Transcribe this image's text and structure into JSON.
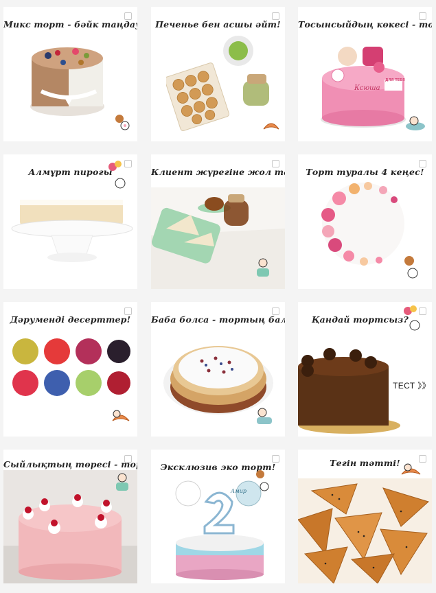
{
  "posts": [
    {
      "caption": "Микс торт - бәйк таңдау!"
    },
    {
      "caption": "Печенье бен асшы әйт!"
    },
    {
      "caption": "Тосынсыйдың көкесі - торт!"
    },
    {
      "caption": "Алмұрт пирогы"
    },
    {
      "caption": "Клиент жүрегіне жол тап!"
    },
    {
      "caption": "Торт туралы 4 кеңес!"
    },
    {
      "caption": "Дәрумендi десерттер!"
    },
    {
      "caption": "Баба болса - тортың бал!"
    },
    {
      "caption": "Қандай тортсыз?"
    },
    {
      "caption": "Сыйлықтың төресі - торт!"
    },
    {
      "caption": "Эксклюзив эко торт!"
    },
    {
      "caption": "Тегін тәтті!"
    }
  ],
  "test_label": "ТЕСТ 》》",
  "cake_labels": {
    "name": "Ксюша",
    "tag": "ДЛЯ ТЕБЯ",
    "topper": "Амир"
  },
  "colors": {
    "accent": "#e8894a",
    "pink": "#f08fb4",
    "cream": "#f6ead6"
  }
}
